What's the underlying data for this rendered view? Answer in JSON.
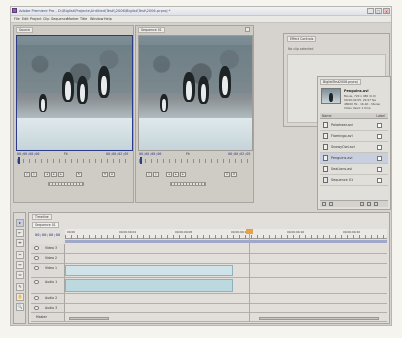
{
  "window": {
    "title": "Adobe Premiere Pro - D:\\Biglist\\Projects\\Untitled\\Test\\\\2006\\Biglist\\Test\\2006.prproj *",
    "minimize_label": "_",
    "maximize_label": "□",
    "close_label": "x"
  },
  "menu": [
    "File",
    "Edit",
    "Project",
    "Clip",
    "Sequence",
    "Marker",
    "Title",
    "Window",
    "Help"
  ],
  "source_monitor": {
    "tab": "Source",
    "timecode_left": "00;00;00;00",
    "timecode_right": "00;00;02;05",
    "zoom": "Fit"
  },
  "program_monitor": {
    "tab": "Sequence 01",
    "timecode_left": "00;00;00;00",
    "timecode_right": "00;00;02;05",
    "zoom": "Fit"
  },
  "effect_controls": {
    "tab": "Effect Controls",
    "info": "No clip selected"
  },
  "project": {
    "tab": "BiglistTest2006.prproj",
    "preview_name": "Penguins.avi",
    "preview_meta": [
      "Movie, 720 x 480 (0.9)",
      "00;00;02;05, 29.97 fps",
      "48000 Hz - 16-bit - Stereo",
      "Video Used: 1 time"
    ],
    "column_name": "Name",
    "column_label": "Label",
    "items": [
      "Polarbear.avi",
      "Flamingo.avi",
      "SnowyOwl.avi",
      "Penguins.avi",
      "SeaLions.avi",
      "Sequence 01"
    ]
  },
  "timeline": {
    "tab": "Timeline",
    "sequence_tab": "Sequence 01",
    "timecode": "00;00;00;00",
    "ruler_labels": [
      "00;00",
      "00;00;00;04",
      "00;00;00;08",
      "00;00;00;12",
      "00;00;00;16",
      "00;00;00;20"
    ],
    "tracks": [
      "Video 3",
      "Video 2",
      "Video 1",
      "Audio 1",
      "Audio 2",
      "Audio 3",
      "Master"
    ]
  },
  "tools": [
    "▸",
    "⇤",
    "⇹",
    "✂",
    "↔",
    "⇔",
    "✎",
    "✋",
    "🔍"
  ],
  "colors": {
    "timecode": "#2d3f86",
    "clip_video": "#cfe3e8",
    "clip_audio": "#bcd9df",
    "playhead": "#e6a04a"
  }
}
